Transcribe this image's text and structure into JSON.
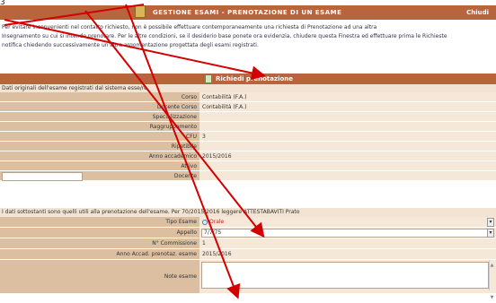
{
  "header": {
    "top_number": "3",
    "title": "GESTIONE ESAMI - PRENOTAZIONE DI UN ESAME",
    "close_label": "Chiudi"
  },
  "intro": {
    "line1": "Per evitare inconvenienti nel contatto richiesto, non è possibile effettuare contemporaneamente una richiesta di Prenotazione ad una altra",
    "line2": "Insegnamento su cui si intende prenotare. Per le altre condizioni, se il desiderio base ponete ora evidenzia, chiudere questa Finestra ed effettuare prima le Richieste",
    "line3": "notifica chiedendo successivamente un'altra argomentazione progettata degli esami registrati."
  },
  "section": {
    "title": "Richiedi prenotazione",
    "subhead": "Dati originali dell'esame registrati dal sistema esse/re"
  },
  "exam_rows": [
    {
      "label": "Corso",
      "value": "Contabilità (F.A.)"
    },
    {
      "label": "Docente Corso",
      "value": "Contabilità (F.A.)"
    },
    {
      "label": "Specializzazione",
      "value": ""
    },
    {
      "label": "Raggruppamento",
      "value": ""
    },
    {
      "label": "CFU",
      "value": "3"
    },
    {
      "label": "Ripetibile",
      "value": ""
    },
    {
      "label": "Anno accademico",
      "value": "2015/2016"
    },
    {
      "label": "Attivo",
      "value": ""
    },
    {
      "label": "Docente",
      "value": ""
    }
  ],
  "note": "I dati sottostanti sono quelli utili alla prenotazione dell'esame. Per 70/2015/2016 leggere ATTESTABAVITI Prato",
  "form": {
    "tipo_esame_label": "Tipo Esame",
    "tipo_esame_option": "Orale",
    "appello_label": "Appello",
    "appello_value": "7/7/75",
    "commissione_label": "N° Commissione",
    "commissione_value": "1",
    "anno_label": "Anno Accad. prenotaz. esame",
    "anno_value": "2015/2016",
    "note_label": "Note esame",
    "note_value": ""
  },
  "colors": {
    "title_bar": "#b8643d",
    "label_bg": "#dcbfa0",
    "value_bg": "#f6e8d8",
    "arrow": "#d40000"
  }
}
